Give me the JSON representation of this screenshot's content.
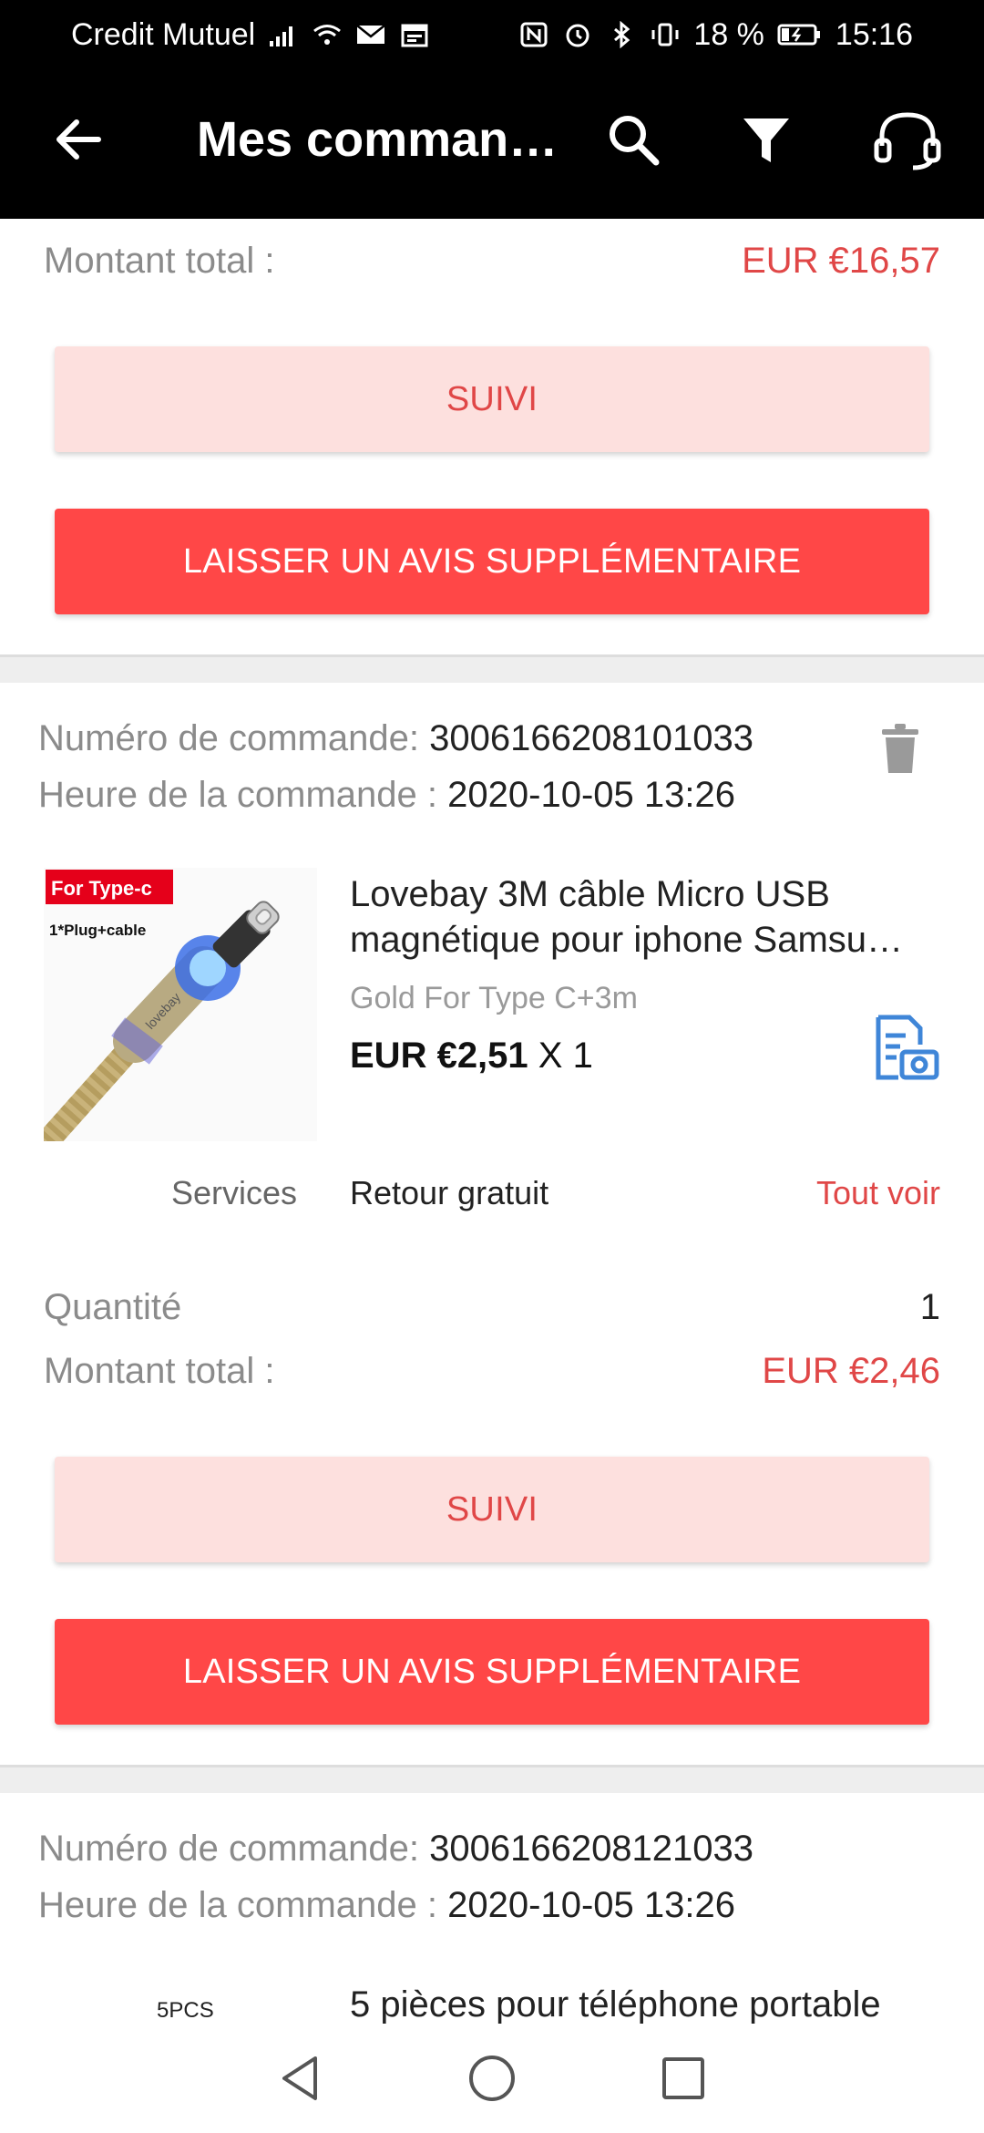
{
  "status_bar": {
    "carrier": "Credit Mutuel",
    "battery": "18 %",
    "time": "15:16"
  },
  "app_bar": {
    "title": "Mes comman…"
  },
  "order_prev": {
    "total_label": "Montant total :",
    "total_value": "EUR €16,57",
    "track_button": "SUIVI",
    "review_button": "LAISSER UN AVIS SUPPLÉMENTAIRE"
  },
  "order_1": {
    "number_label": "Numéro de commande:",
    "number_value": "3006166208101033",
    "time_label": "Heure de la commande :",
    "time_value": "2020-10-05 13:26",
    "product": {
      "image_badge": "For Type-c",
      "image_caption": "1*Plug+cable",
      "cable_print": "lovebay",
      "title": "Lovebay 3M câble Micro USB magnétique pour iphone Samsu…",
      "variant": "Gold For Type C+3m",
      "price": "EUR €2,51",
      "qty_mult": "X 1"
    },
    "services_label": "Services",
    "services_value": "Retour gratuit",
    "services_link": "Tout voir",
    "quantity_label": "Quantité",
    "quantity_value": "1",
    "total_label": "Montant total :",
    "total_value": "EUR €2,46",
    "track_button": "SUIVI",
    "review_button": "LAISSER UN AVIS SUPPLÉMENTAIRE"
  },
  "order_2": {
    "number_label": "Numéro de commande:",
    "number_value": "3006166208121033",
    "time_label": "Heure de la commande :",
    "time_value": "2020-10-05 13:26",
    "image_tag": "5PCS",
    "product_title": "5 pièces pour téléphone portable"
  },
  "colors": {
    "accent": "#ff4747",
    "accent_light": "#fde0de",
    "price_red": "#e04747",
    "icon_blue": "#3f86d8"
  }
}
